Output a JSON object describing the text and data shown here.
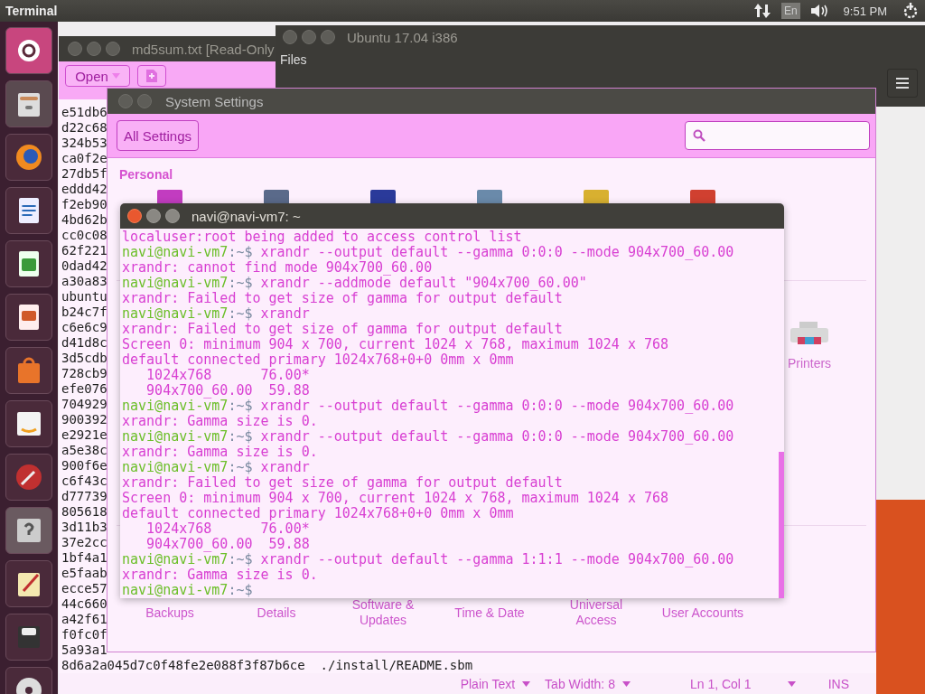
{
  "top_bar": {
    "app_title": "Terminal",
    "keyboard": "En",
    "clock": "9:51 PM"
  },
  "editor": {
    "title": "md5sum.txt [Read-Only",
    "open_button": "Open",
    "lines": [
      "e51db6",
      "d22c68",
      "324b53",
      "ca0f2e",
      "27db5f",
      "eddd42",
      "f2eb90",
      "4bd62b",
      "cc0c08",
      "62f221",
      "0dad42",
      "a30a83",
      "ubuntu",
      "b24c7f",
      "c6e6c9",
      "d41d8c",
      "3d5cdb",
      "728cb9",
      "efe076",
      "704929",
      "900392",
      "e2921e",
      "a5e38c",
      "900f6e",
      "c6f43c",
      "d77739",
      "805618",
      "3d11b3",
      "37e2cc",
      "1bf4a1",
      "e5faab",
      "ecce57",
      "44c660",
      "a42f61",
      "f0fc0f",
      "5a93a1",
      "8d6a2a045d7c0f48fe2e088f3f87b6ce  ./install/README.sbm"
    ],
    "status": {
      "language": "Plain Text",
      "tab_width": "Tab Width: 8",
      "position": "Ln 1, Col 1",
      "mode": "INS"
    }
  },
  "files": {
    "title": "Ubuntu 17.04 i386",
    "menu": "Files"
  },
  "settings": {
    "title": "System Settings",
    "all_settings": "All Settings",
    "section": "Personal",
    "printers": "Printers",
    "bottom_items": [
      "Backups",
      "Details",
      "Software & Updates",
      "Time & Date",
      "Universal Access",
      "User Accounts"
    ]
  },
  "terminal": {
    "title": "navi@navi-vm7: ~",
    "lines": [
      {
        "kind": "output",
        "text": "localuser:root being added to access control list"
      },
      {
        "kind": "prompt",
        "user": "navi@navi-vm7",
        "prompt_end": ":~$",
        "command": " xrandr --output default --gamma 0:0:0 --mode 904x700_60.00"
      },
      {
        "kind": "output",
        "text": "xrandr: cannot find mode 904x700_60.00"
      },
      {
        "kind": "prompt",
        "user": "navi@navi-vm7",
        "prompt_end": ":~$",
        "command": " xrandr --addmode default \"904x700_60.00\""
      },
      {
        "kind": "output",
        "text": "xrandr: Failed to get size of gamma for output default"
      },
      {
        "kind": "prompt",
        "user": "navi@navi-vm7",
        "prompt_end": ":~$",
        "command": " xrandr"
      },
      {
        "kind": "output",
        "text": "xrandr: Failed to get size of gamma for output default"
      },
      {
        "kind": "output",
        "text": "Screen 0: minimum 904 x 700, current 1024 x 768, maximum 1024 x 768"
      },
      {
        "kind": "output",
        "text": "default connected primary 1024x768+0+0 0mm x 0mm"
      },
      {
        "kind": "output",
        "text": "   1024x768      76.00*"
      },
      {
        "kind": "output",
        "text": "   904x700_60.00  59.88"
      },
      {
        "kind": "prompt",
        "user": "navi@navi-vm7",
        "prompt_end": ":~$",
        "command": " xrandr --output default --gamma 0:0:0 --mode 904x700_60.00"
      },
      {
        "kind": "output",
        "text": "xrandr: Gamma size is 0."
      },
      {
        "kind": "prompt",
        "user": "navi@navi-vm7",
        "prompt_end": ":~$",
        "command": " xrandr --output default --gamma 0:0:0 --mode 904x700_60.00"
      },
      {
        "kind": "output",
        "text": "xrandr: Gamma size is 0."
      },
      {
        "kind": "prompt",
        "user": "navi@navi-vm7",
        "prompt_end": ":~$",
        "command": " xrandr"
      },
      {
        "kind": "output",
        "text": "xrandr: Failed to get size of gamma for output default"
      },
      {
        "kind": "output",
        "text": "Screen 0: minimum 904 x 700, current 1024 x 768, maximum 1024 x 768"
      },
      {
        "kind": "output",
        "text": "default connected primary 1024x768+0+0 0mm x 0mm"
      },
      {
        "kind": "output",
        "text": "   1024x768      76.00*"
      },
      {
        "kind": "output",
        "text": "   904x700_60.00  59.88"
      },
      {
        "kind": "prompt",
        "user": "navi@navi-vm7",
        "prompt_end": ":~$",
        "command": " xrandr --output default --gamma 1:1:1 --mode 904x700_60.00"
      },
      {
        "kind": "output",
        "text": "xrandr: Gamma size is 0."
      },
      {
        "kind": "prompt",
        "user": "navi@navi-vm7",
        "prompt_end": ":~$"
      }
    ]
  }
}
